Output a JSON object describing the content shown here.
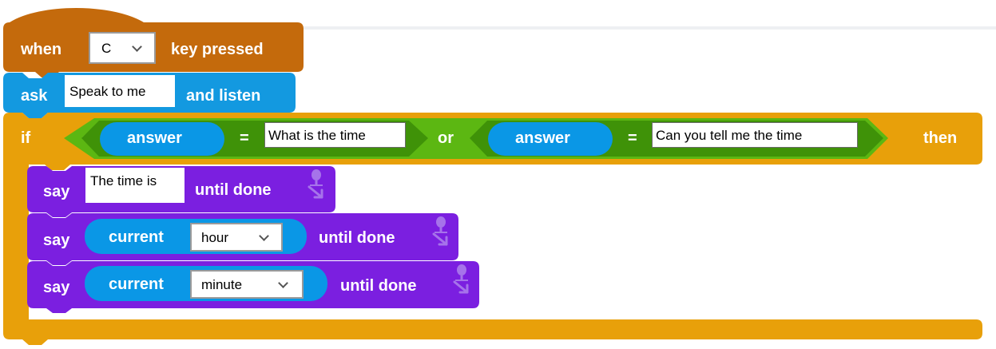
{
  "colors": {
    "event_hat": "#c46a0c",
    "sensing_blue": "#1399e0",
    "reporter_blue": "#0a97e6",
    "control_orange": "#e8a00a",
    "operator_green": "#5cb712",
    "operator_green_dark": "#3f9208",
    "looks_purple": "#7b1fe0",
    "looks_purple_light": "#a673ea"
  },
  "hat_block": {
    "prefix": "when",
    "key_value": "C",
    "suffix": "key pressed"
  },
  "ask_block": {
    "label": "ask",
    "input_value": "Speak to me",
    "suffix": "and listen"
  },
  "if_block": {
    "label": "if",
    "then_label": "then",
    "condition": {
      "left": {
        "reporter": "answer",
        "operator": "=",
        "value": "What is the time"
      },
      "joiner": "or",
      "right": {
        "reporter": "answer",
        "operator": "=",
        "value": "Can you tell me the time"
      }
    }
  },
  "say_blocks": [
    {
      "label": "say",
      "input_value": "The time is",
      "suffix": "until done",
      "icon": "microphone-icon"
    },
    {
      "label": "say",
      "reporter": "current",
      "dropdown_value": "hour",
      "suffix": "until done",
      "icon": "microphone-icon"
    },
    {
      "label": "say",
      "reporter": "current",
      "dropdown_value": "minute",
      "suffix": "until done",
      "icon": "microphone-icon"
    }
  ]
}
